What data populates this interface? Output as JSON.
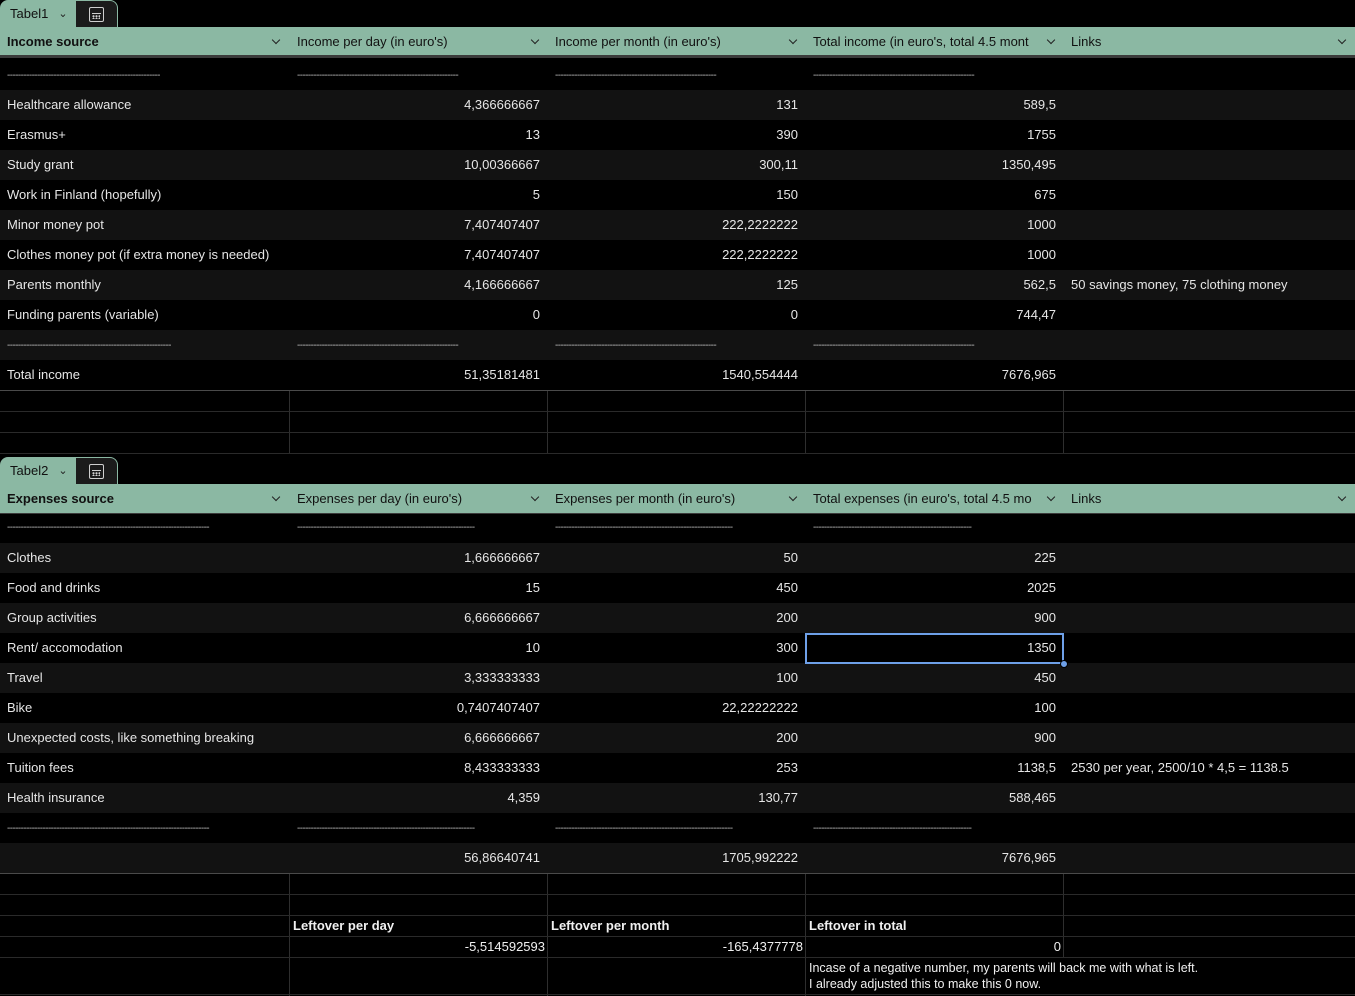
{
  "table1": {
    "tab_name": "Tabel1",
    "headers": [
      "Income source",
      "Income per day  (in euro's)",
      "Income per month  (in euro's)",
      "Total income  (in euro's, total 4.5 mont",
      "Links"
    ],
    "dash_top": [
      "--------------------------------------------------------",
      "-----------------------------------------------------------",
      "-----------------------------------------------------------",
      "-----------------------------------------------------------",
      ""
    ],
    "rows": [
      {
        "source": "Healthcare allowance",
        "per_day": "4,366666667",
        "per_month": "131",
        "total": "589,5",
        "links": ""
      },
      {
        "source": "Erasmus+",
        "per_day": "13",
        "per_month": "390",
        "total": "1755",
        "links": ""
      },
      {
        "source": "Study grant",
        "per_day": "10,00366667",
        "per_month": "300,11",
        "total": "1350,495",
        "links": ""
      },
      {
        "source": "Work in Finland (hopefully)",
        "per_day": "5",
        "per_month": "150",
        "total": "675",
        "links": ""
      },
      {
        "source": "Minor money pot",
        "per_day": "7,407407407",
        "per_month": "222,2222222",
        "total": "1000",
        "links": ""
      },
      {
        "source": "Clothes money pot (if extra money is needed)",
        "per_day": "7,407407407",
        "per_month": "222,2222222",
        "total": "1000",
        "links": ""
      },
      {
        "source": "Parents monthly",
        "per_day": "4,166666667",
        "per_month": "125",
        "total": "562,5",
        "links": "50 savings money, 75 clothing money"
      },
      {
        "source": "Funding parents (variable)",
        "per_day": "0",
        "per_month": "0",
        "total": "744,47",
        "links": ""
      }
    ],
    "dash_bottom": [
      "------------------------------------------------------------",
      "-----------------------------------------------------------",
      "-----------------------------------------------------------",
      "-----------------------------------------------------------",
      ""
    ],
    "total_row": {
      "source": "Total income",
      "per_day": "51,35181481",
      "per_month": "1540,554444",
      "total": "7676,965",
      "links": ""
    }
  },
  "table2": {
    "tab_name": "Tabel2",
    "headers": [
      "Expenses source",
      "Expenses per day  (in euro's)",
      "Expenses per month  (in euro's)",
      "Total expenses  (in euro's, total 4.5 mo",
      "Links"
    ],
    "dash_top": [
      "--------------------------------------------------------------------------",
      "-----------------------------------------------------------------",
      "-----------------------------------------------------------------",
      "----------------------------------------------------------",
      ""
    ],
    "rows": [
      {
        "source": "Clothes",
        "per_day": "1,666666667",
        "per_month": "50",
        "total": "225",
        "links": ""
      },
      {
        "source": "Food and drinks",
        "per_day": "15",
        "per_month": "450",
        "total": "2025",
        "links": ""
      },
      {
        "source": "Group activities",
        "per_day": "6,666666667",
        "per_month": "200",
        "total": "900",
        "links": ""
      },
      {
        "source": "Rent/ accomodation",
        "per_day": "10",
        "per_month": "300",
        "total": "1350",
        "links": ""
      },
      {
        "source": "Travel",
        "per_day": "3,333333333",
        "per_month": "100",
        "total": "450",
        "links": ""
      },
      {
        "source": "Bike",
        "per_day": "0,7407407407",
        "per_month": "22,22222222",
        "total": "100",
        "links": ""
      },
      {
        "source": "Unexpected costs, like something breaking",
        "per_day": "6,666666667",
        "per_month": "200",
        "total": "900",
        "links": ""
      },
      {
        "source": "Tuition fees",
        "per_day": "8,433333333",
        "per_month": "253",
        "total": "1138,5",
        "links": "2530 per year, 2500/10 * 4,5 = 1138.5"
      },
      {
        "source": "Health insurance",
        "per_day": "4,359",
        "per_month": "130,77",
        "total": "588,465",
        "links": ""
      }
    ],
    "dash_bottom": [
      "--------------------------------------------------------------------------",
      "-----------------------------------------------------------------",
      "-----------------------------------------------------------------",
      "----------------------------------------------------------",
      ""
    ],
    "total_row": {
      "source": "",
      "per_day": "56,86640741",
      "per_month": "1705,992222",
      "total": "7676,965",
      "links": ""
    }
  },
  "leftover": {
    "per_day_label": "Leftover per day",
    "per_month_label": "Leftover per month",
    "total_label": "Leftover in total",
    "per_day_value": "-5,514592593",
    "per_month_value": "-165,4377778",
    "total_value": "0",
    "note_line1": "Incase of a negative number, my parents will back me with what is left.",
    "note_line2": "I already adjusted this to make this 0 now."
  },
  "colors": {
    "header_bg": "#8bb8a3",
    "selection": "#6ea0e8",
    "background": "#000000"
  },
  "icons": {
    "tab_dropdown": "chevron-down-icon",
    "tab_calc": "calculator-icon",
    "column_menu": "chevron-down-icon"
  }
}
